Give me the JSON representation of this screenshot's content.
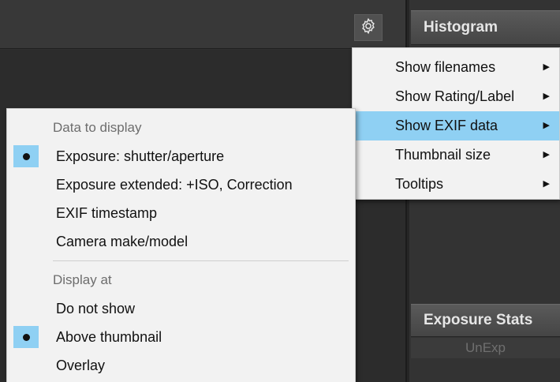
{
  "toolbar": {
    "settings_icon": "gear-icon"
  },
  "right_panel": {
    "histogram_title": "Histogram",
    "exposure_stats_title": "Exposure Stats",
    "unexp_label": "UnExp"
  },
  "main_menu": {
    "items": [
      {
        "label": "Show filenames",
        "has_submenu": true,
        "active": false
      },
      {
        "label": "Show Rating/Label",
        "has_submenu": true,
        "active": false
      },
      {
        "label": "Show EXIF data",
        "has_submenu": true,
        "active": true
      },
      {
        "label": "Thumbnail size",
        "has_submenu": true,
        "active": false
      },
      {
        "label": "Tooltips",
        "has_submenu": true,
        "active": false
      }
    ],
    "arrow_glyph": "▶"
  },
  "exif_submenu": {
    "section1_heading": "Data to display",
    "section1_items": [
      {
        "label": "Exposure: shutter/aperture",
        "selected": true
      },
      {
        "label": "Exposure extended: +ISO, Correction",
        "selected": false
      },
      {
        "label": "EXIF timestamp",
        "selected": false
      },
      {
        "label": "Camera make/model",
        "selected": false
      }
    ],
    "section2_heading": "Display at",
    "section2_items": [
      {
        "label": "Do not show",
        "selected": false
      },
      {
        "label": "Above thumbnail",
        "selected": true
      },
      {
        "label": "Overlay",
        "selected": false
      }
    ]
  },
  "colors": {
    "accent_highlight": "#8fd0f3",
    "menu_background": "#f2f2f2",
    "app_background": "#2f2f2f"
  }
}
